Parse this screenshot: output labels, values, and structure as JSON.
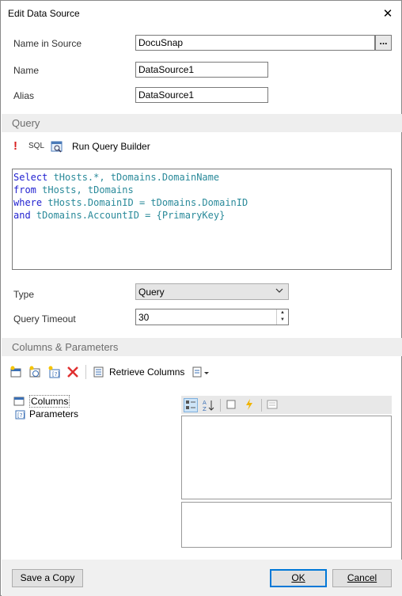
{
  "window": {
    "title": "Edit Data Source",
    "close_glyph": "✕"
  },
  "fields": {
    "name_in_source": {
      "label": "Name in Source",
      "value": "DocuSnap",
      "browse": "..."
    },
    "name": {
      "label": "Name",
      "value": "DataSource1"
    },
    "alias": {
      "label": "Alias",
      "value": "DataSource1"
    }
  },
  "query_section": {
    "title": "Query",
    "toolbar": {
      "error_glyph": "!",
      "sql_label": "SQL",
      "run_builder_label": "Run Query Builder"
    },
    "code_lines": [
      [
        {
          "t": "Select",
          "c": "kw"
        },
        {
          "t": " tHosts.*, tDomains.DomainName",
          "c": "id"
        }
      ],
      [
        {
          "t": "from",
          "c": "kw"
        },
        {
          "t": " tHosts, tDomains",
          "c": "id"
        }
      ],
      [
        {
          "t": "where",
          "c": "kw"
        },
        {
          "t": " tHosts.DomainID = tDomains.DomainID",
          "c": "id"
        }
      ],
      [
        {
          "t": "and",
          "c": "kw"
        },
        {
          "t": " tDomains.AccountID = {PrimaryKey}",
          "c": "id"
        }
      ]
    ],
    "type": {
      "label": "Type",
      "value": "Query"
    },
    "timeout": {
      "label": "Query Timeout",
      "value": "30"
    }
  },
  "columns_section": {
    "title": "Columns & Parameters",
    "retrieve_label": "Retrieve Columns",
    "tree": [
      {
        "label": "Columns"
      },
      {
        "label": "Parameters"
      }
    ]
  },
  "buttons": {
    "save_copy": "Save a Copy",
    "ok": "OK",
    "cancel": "Cancel"
  },
  "colors": {
    "section_bg": "#eeeeee",
    "keyword": "#1f1fd0",
    "identifier": "#2a8a9a",
    "ok_border": "#0078d7",
    "error": "#d81e1e"
  }
}
